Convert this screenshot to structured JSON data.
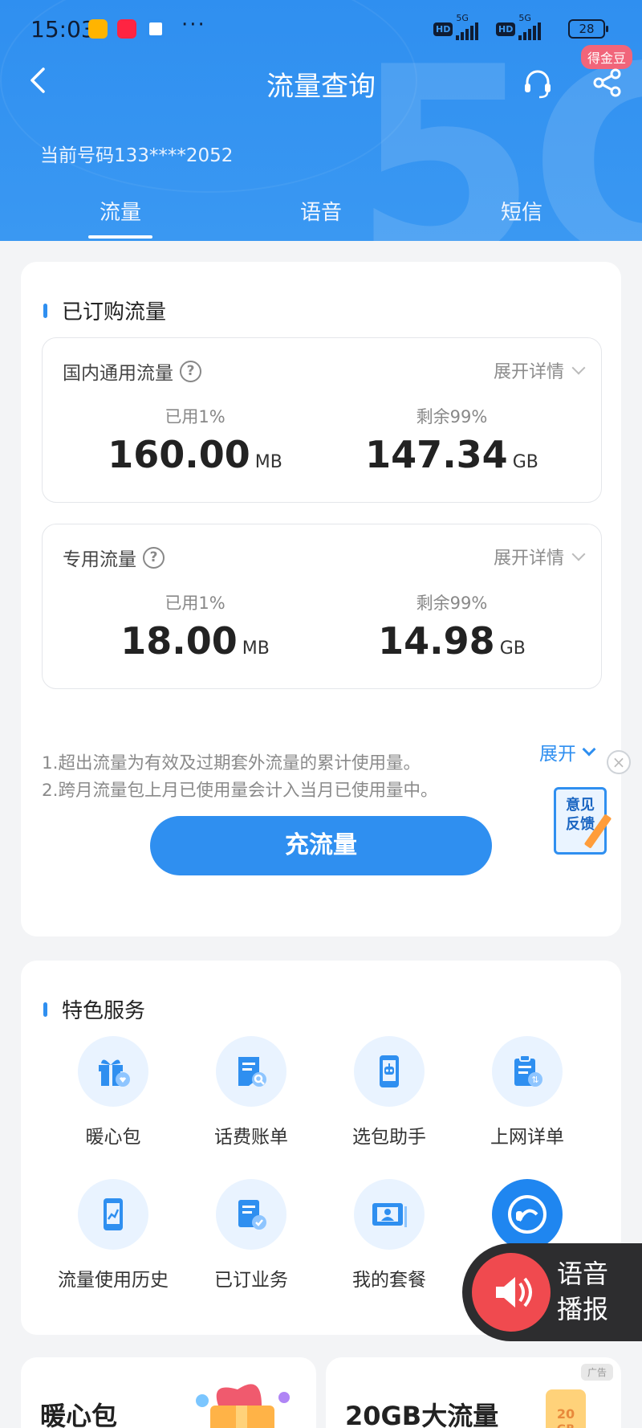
{
  "status_bar": {
    "time": "15:03",
    "battery": "28",
    "network": [
      "5G",
      "5G"
    ],
    "hd": "HD",
    "more": "···"
  },
  "header": {
    "title": "流量查询",
    "coin_badge": "得金豆",
    "phone_number": "当前号码133****2052",
    "tabs": [
      {
        "label": "流量",
        "active": true
      },
      {
        "label": "语音",
        "active": false
      },
      {
        "label": "短信",
        "active": false
      }
    ],
    "icons": [
      "back-icon",
      "headset-icon",
      "share-icon"
    ]
  },
  "subscribed": {
    "title": "已订购流量",
    "plans": [
      {
        "name": "国内通用流量",
        "expand_label": "展开详情",
        "used_label": "已用1%",
        "used_value": "160.00",
        "used_unit": "MB",
        "remain_label": "剩余99%",
        "remain_value": "147.34",
        "remain_unit": "GB"
      },
      {
        "name": "专用流量",
        "expand_label": "展开详情",
        "used_label": "已用1%",
        "used_value": "18.00",
        "used_unit": "MB",
        "remain_label": "剩余99%",
        "remain_value": "14.98",
        "remain_unit": "GB"
      }
    ],
    "notes": [
      "1.超出流量为有效及过期套外流量的累计使用量。",
      "2.跨月流量包上月已使用量会计入当月已使用量中。"
    ],
    "more_label": "展开",
    "recharge_label": "充流量"
  },
  "feedback": {
    "label_line1": "意见",
    "label_line2": "反馈",
    "close": "×"
  },
  "services": {
    "title": "特色服务",
    "items": [
      {
        "label": "暖心包",
        "icon": "gift-icon"
      },
      {
        "label": "话费账单",
        "icon": "bill-search-icon"
      },
      {
        "label": "选包助手",
        "icon": "robot-phone-icon"
      },
      {
        "label": "上网详单",
        "icon": "clipboard-icon"
      },
      {
        "label": "流量使用历史",
        "icon": "phone-chart-icon"
      },
      {
        "label": "已订业务",
        "icon": "document-check-icon"
      },
      {
        "label": "我的套餐",
        "icon": "id-card-icon"
      },
      {
        "label": "",
        "icon": "customer-service-icon"
      }
    ]
  },
  "voice_broadcast": {
    "line1": "语音",
    "line2": "播报"
  },
  "promos": [
    {
      "title": "暖心包"
    },
    {
      "title": "20GB大流量",
      "ad_tag": "广告"
    }
  ],
  "colors": {
    "brand_blue": "#2f8ff0",
    "coin_badge": "#f1657a",
    "voice_red": "#f04a4f"
  }
}
